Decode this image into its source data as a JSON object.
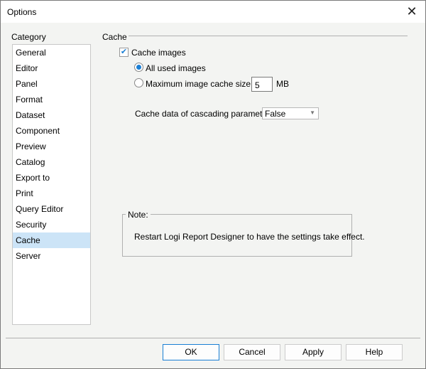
{
  "window": {
    "title": "Options"
  },
  "category": {
    "label": "Category",
    "items": [
      "General",
      "Editor",
      "Panel",
      "Format",
      "Dataset",
      "Component",
      "Preview",
      "Catalog",
      "Export to",
      "Print",
      "Query Editor",
      "Security",
      "Cache",
      "Server"
    ],
    "selected": "Cache"
  },
  "cache": {
    "group_label": "Cache",
    "cache_images_label": "Cache images",
    "cache_images_checked": true,
    "all_used_label": "All used images",
    "max_size_label": "Maximum image cache size:",
    "max_size_value": "5",
    "unit": "MB",
    "selected_option": "All used images",
    "cascading_label": "Cache data of cascading paramete...",
    "cascading_value": "False"
  },
  "note": {
    "label": "Note:",
    "text": "Restart Logi Report Designer to have the settings take effect."
  },
  "buttons": {
    "ok": "OK",
    "cancel": "Cancel",
    "apply": "Apply",
    "help": "Help"
  },
  "colors": {
    "accent": "#1a7fd4",
    "selection": "#cce4f7"
  }
}
